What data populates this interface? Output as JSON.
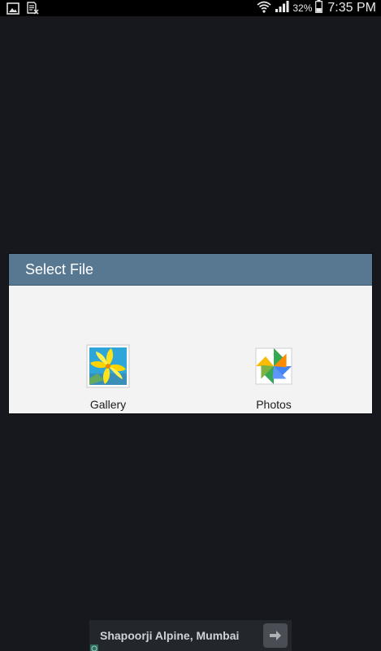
{
  "status_bar": {
    "battery_percent": "32%",
    "time": "7:35 PM",
    "icons": [
      "image-notification-icon",
      "document-notification-icon",
      "wifi-icon",
      "signal-icon",
      "battery-icon"
    ]
  },
  "dialog": {
    "title": "Select File",
    "apps": [
      {
        "label": "Gallery",
        "icon": "gallery-icon"
      },
      {
        "label": "Photos",
        "icon": "photos-pinwheel-icon"
      }
    ]
  },
  "ad": {
    "text": "Shapoorji Alpine, Mumbai",
    "icon": "arrow-right-icon"
  },
  "colors": {
    "background": "#16181d",
    "dialog_header": "#587892",
    "dialog_body": "#f3f3f3",
    "status_bar": "#000000"
  }
}
